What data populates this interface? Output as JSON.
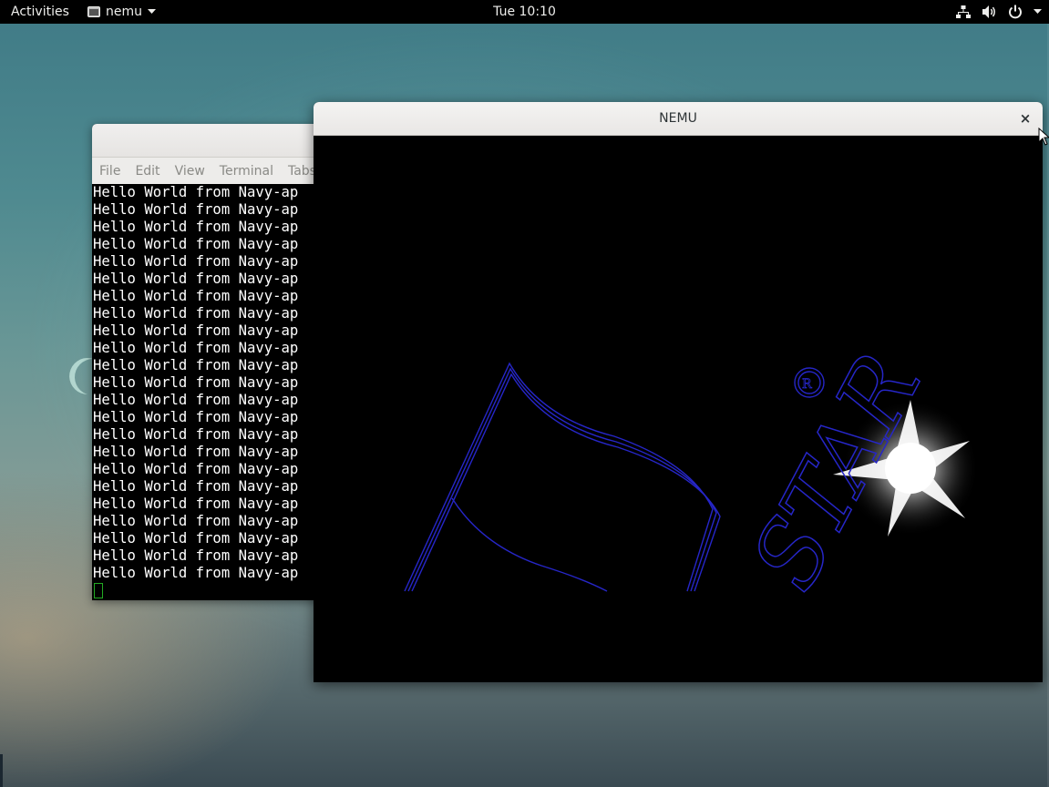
{
  "topbar": {
    "activities_label": "Activities",
    "app_name": "nemu",
    "clock": "Tue 10:10",
    "icons": [
      "network-icon",
      "volume-icon",
      "power-icon",
      "chevron-down-icon"
    ]
  },
  "terminal": {
    "menu": [
      "File",
      "Edit",
      "View",
      "Terminal",
      "Tabs"
    ],
    "lines": [
      "Hello World from Navy-ap",
      "Hello World from Navy-ap",
      "Hello World from Navy-ap",
      "Hello World from Navy-ap",
      "Hello World from Navy-ap",
      "Hello World from Navy-ap",
      "Hello World from Navy-ap",
      "Hello World from Navy-ap",
      "Hello World from Navy-ap",
      "Hello World from Navy-ap",
      "Hello World from Navy-ap",
      "Hello World from Navy-ap",
      "Hello World from Navy-ap",
      "Hello World from Navy-ap",
      "Hello World from Navy-ap",
      "Hello World from Navy-ap",
      "Hello World from Navy-ap",
      "Hello World from Navy-ap",
      "Hello World from Navy-ap",
      "Hello World from Navy-ap",
      "Hello World from Navy-ap",
      "Hello World from Navy-ap",
      "Hello World from Navy-ap"
    ],
    "cursor_color": "#22a922"
  },
  "nemu_window": {
    "title": "NEMU",
    "close_glyph": "×",
    "logo_text": "STAR",
    "logo_color": "#2626c8"
  },
  "colors": {
    "topbar_bg": "#000000",
    "logo_blue": "#2626c8"
  }
}
